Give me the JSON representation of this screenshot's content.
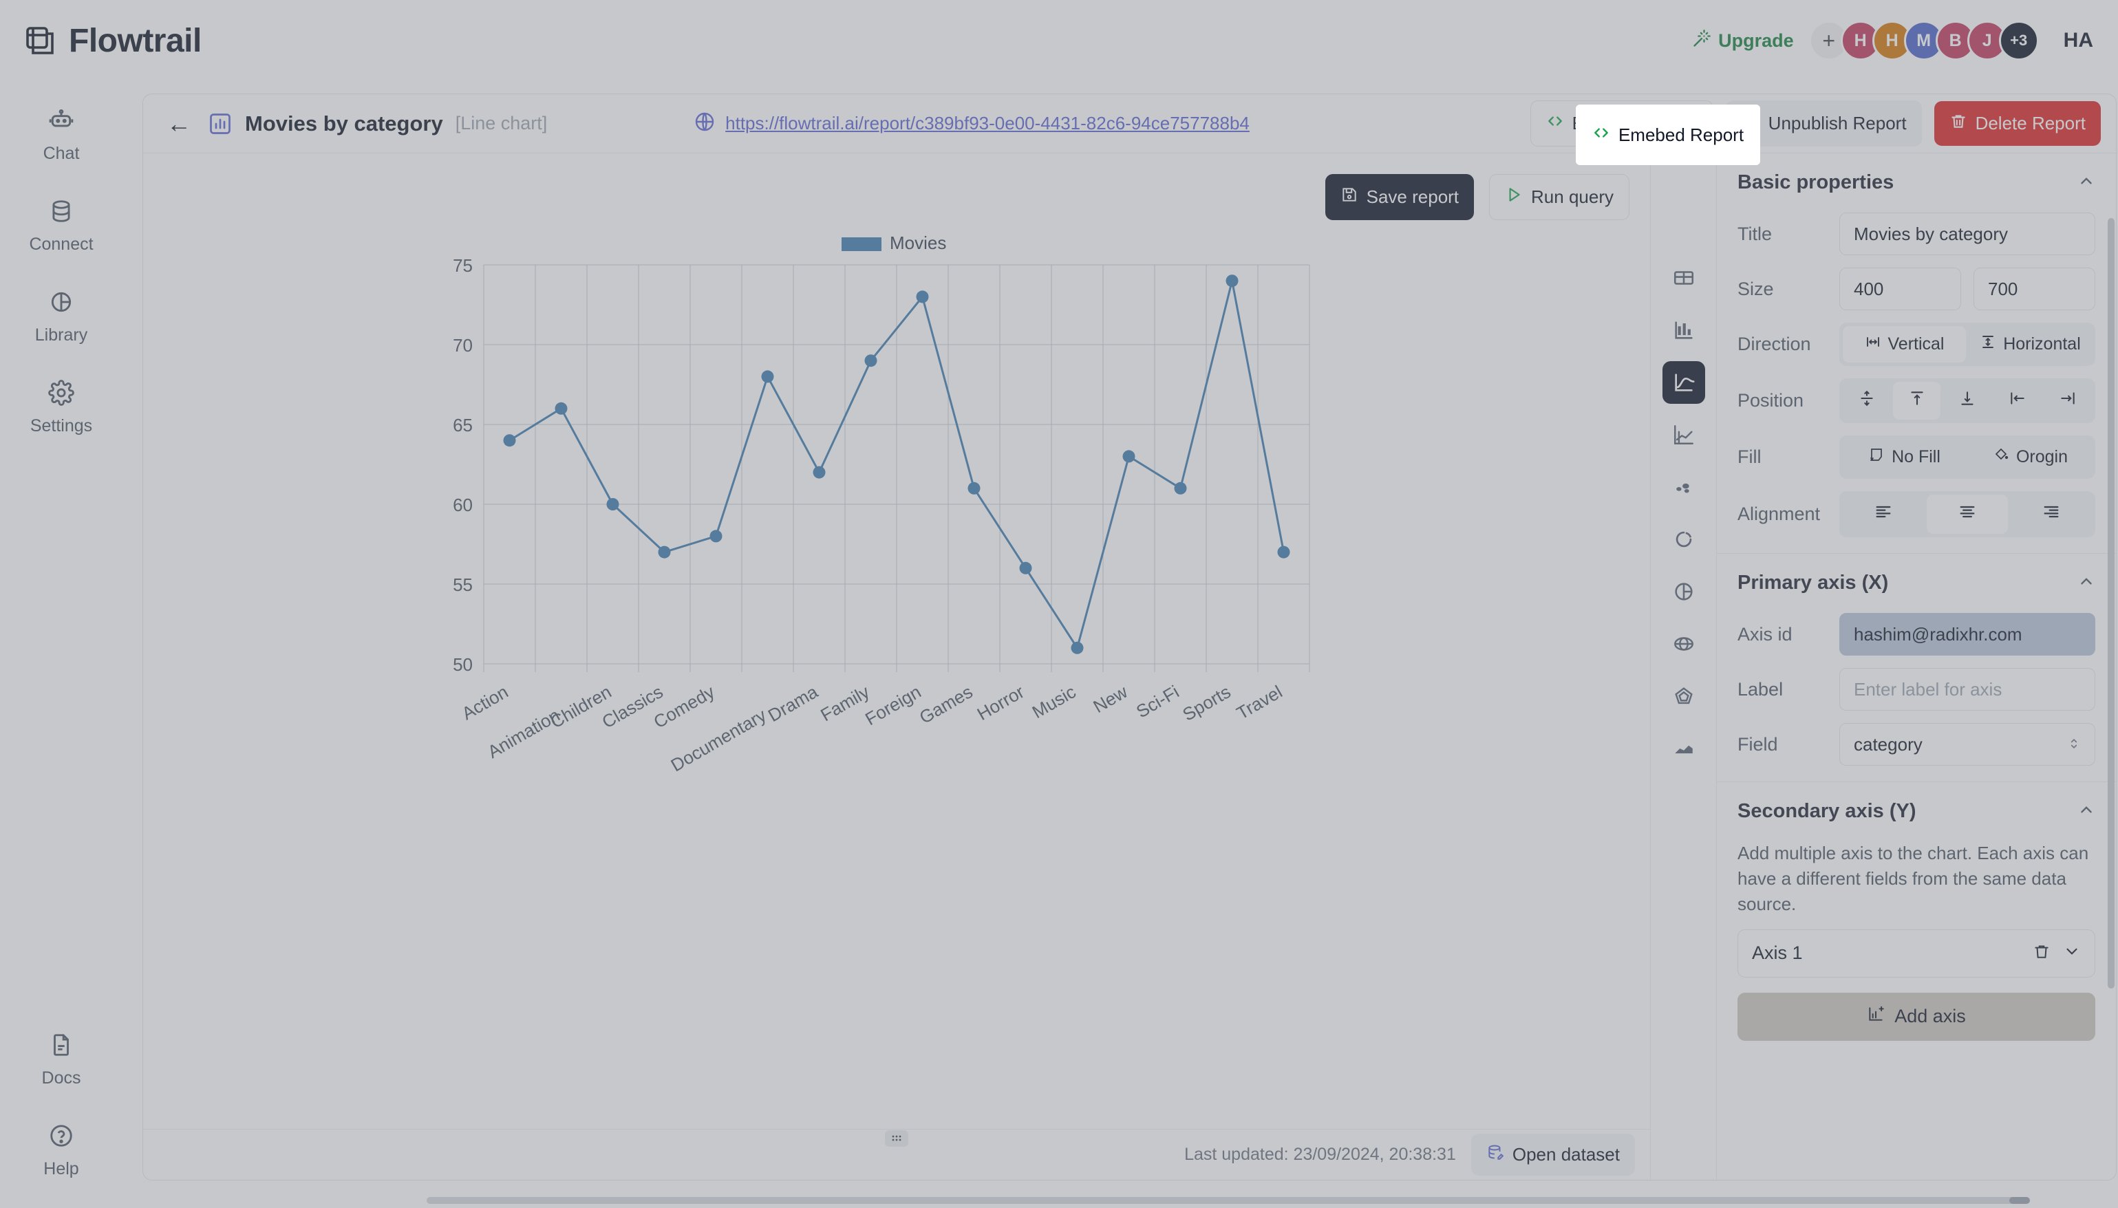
{
  "app": {
    "brand": "Flowtrail",
    "upgrade_label": "Upgrade",
    "user_initials": "HA"
  },
  "avatars": [
    {
      "label": "+",
      "color": "#f1f1f2"
    },
    {
      "label": "H",
      "color": "#c2385c"
    },
    {
      "label": "H",
      "color": "#d2760a"
    },
    {
      "label": "M",
      "color": "#4a63c8"
    },
    {
      "label": "B",
      "color": "#c2385c"
    },
    {
      "label": "J",
      "color": "#c2385c"
    },
    {
      "label": "+3",
      "color": "#0d1427"
    }
  ],
  "sidebar": {
    "items": [
      {
        "label": "Chat",
        "icon": "robot-icon"
      },
      {
        "label": "Connect",
        "icon": "database-icon"
      },
      {
        "label": "Library",
        "icon": "library-icon"
      },
      {
        "label": "Settings",
        "icon": "gear-icon"
      }
    ],
    "bottom_items": [
      {
        "label": "Docs",
        "icon": "document-icon"
      },
      {
        "label": "Help",
        "icon": "question-circle-icon"
      }
    ]
  },
  "report": {
    "title": "Movies by category",
    "type_tag": "[Line chart]",
    "url": "https://flowtrail.ai/report/c389bf93-0e00-4431-82c6-94ce757788b4",
    "actions": {
      "embed": "Emebed Report",
      "unpublish": "Unpublish Report",
      "delete": "Delete Report"
    },
    "toolbar": {
      "save": "Save report",
      "run": "Run query"
    },
    "status": {
      "last_updated": "Last updated: 23/09/2024, 20:38:31",
      "open_dataset": "Open dataset"
    }
  },
  "chart_types": [
    {
      "name": "table-chart-type",
      "active": false
    },
    {
      "name": "bar-chart-type",
      "active": false
    },
    {
      "name": "line-chart-type",
      "active": true
    },
    {
      "name": "combo-chart-type",
      "active": false
    },
    {
      "name": "scatter-chart-type",
      "active": false
    },
    {
      "name": "donut-chart-type",
      "active": false
    },
    {
      "name": "pie-chart-type",
      "active": false
    },
    {
      "name": "radial-chart-type",
      "active": false
    },
    {
      "name": "radar-chart-type",
      "active": false
    },
    {
      "name": "area-chart-type",
      "active": false
    }
  ],
  "properties": {
    "basic": {
      "heading": "Basic properties",
      "title_label": "Title",
      "title_value": "Movies by category",
      "size_label": "Size",
      "size_width": "400",
      "size_height": "700",
      "direction_label": "Direction",
      "direction_vertical": "Vertical",
      "direction_horizontal": "Horizontal",
      "direction_selected": "Vertical",
      "position_label": "Position",
      "position_selected_index": 1,
      "fill_label": "Fill",
      "fill_none": "No Fill",
      "fill_origin": "Orogin",
      "alignment_label": "Alignment",
      "alignment_selected_index": 1
    },
    "primary_axis": {
      "heading": "Primary axis (X)",
      "axis_id_label": "Axis id",
      "axis_id_value": "hashim@radixhr.com",
      "label_label": "Label",
      "label_placeholder": "Enter label for axis",
      "field_label": "Field",
      "field_value": "category"
    },
    "secondary_axis": {
      "heading": "Secondary axis (Y)",
      "description": "Add multiple axis to the chart. Each axis can have a different fields from the same data source.",
      "axis_name": "Axis 1",
      "add_axis": "Add axis"
    }
  },
  "chart_data": {
    "type": "line",
    "title": "",
    "legend": [
      "Movies"
    ],
    "legend_position": "top",
    "series_color": "#3d7ab0",
    "categories": [
      "Action",
      "Animation",
      "Children",
      "Classics",
      "Comedy",
      "Documentary",
      "Drama",
      "Family",
      "Foreign",
      "Games",
      "Horror",
      "Music",
      "New",
      "Sci-Fi",
      "Sports",
      "Travel"
    ],
    "series": [
      {
        "name": "Movies",
        "values": [
          64,
          66,
          60,
          57,
          58,
          68,
          62,
          69,
          73,
          61,
          56,
          51,
          63,
          61,
          74,
          57
        ]
      }
    ],
    "xlabel": "",
    "ylabel": "",
    "ylim": [
      50,
      75
    ],
    "yticks": [
      50,
      55,
      60,
      65,
      70,
      75
    ],
    "grid": true
  }
}
